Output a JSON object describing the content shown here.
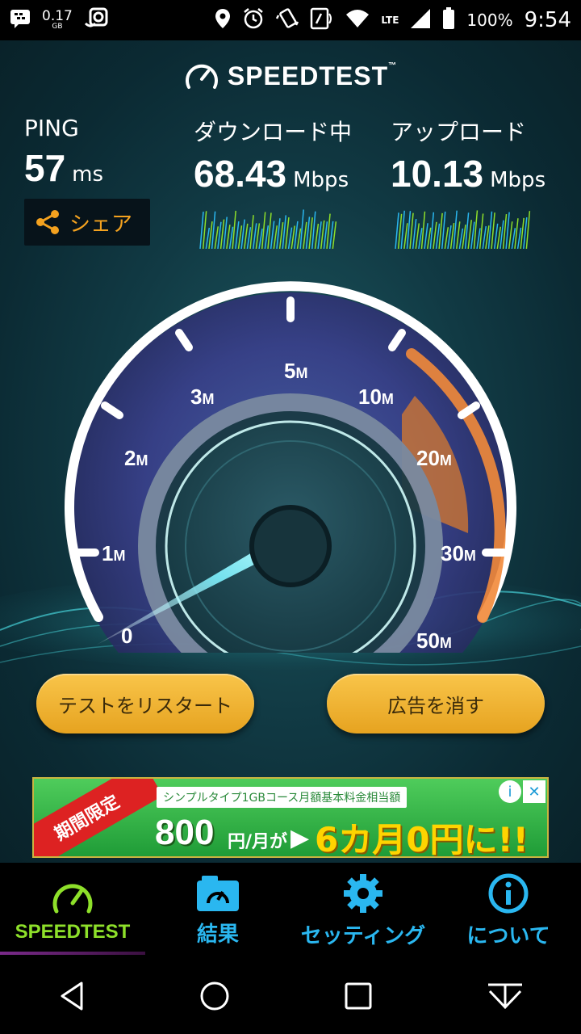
{
  "status_bar": {
    "data_value": "0.17",
    "data_unit": "GB",
    "network": "LTE",
    "battery": "100%",
    "time": "9:54"
  },
  "app": {
    "logo": "SPEEDTEST",
    "tm": "™"
  },
  "ping": {
    "label": "PING",
    "value": "57",
    "unit": "ms"
  },
  "download": {
    "label": "ダウンロード中",
    "value": "68.43",
    "unit": "Mbps"
  },
  "upload": {
    "label": "アップロード",
    "value": "10.13",
    "unit": "Mbps"
  },
  "share": {
    "label": "シェア"
  },
  "gauge": {
    "labels": [
      "0",
      "1",
      "2",
      "3",
      "5",
      "10",
      "20",
      "30",
      "50"
    ],
    "suffix": "M"
  },
  "buttons": {
    "restart": "テストをリスタート",
    "remove_ads": "広告を消す"
  },
  "ad": {
    "band": "期間限定",
    "subtitle": "シンプルタイプ1GBコース月額基本料金相当額",
    "price": "800",
    "per": "円/月が",
    "arrow": "▶",
    "promo": "6カ月0円に!!"
  },
  "bottom_nav": {
    "items": [
      {
        "label": "SPEEDTEST",
        "icon": "gauge-icon"
      },
      {
        "label": "結果",
        "icon": "results-icon"
      },
      {
        "label": "セッティング",
        "icon": "gear-icon"
      },
      {
        "label": "について",
        "icon": "info-icon"
      }
    ]
  },
  "colors": {
    "accent_orange": "#f4a21f",
    "accent_green": "#8ee02a",
    "accent_blue": "#2ab7f0"
  }
}
